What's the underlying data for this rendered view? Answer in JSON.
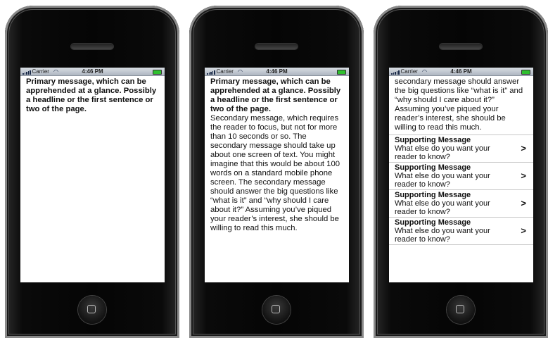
{
  "status": {
    "carrier": "Carrier",
    "time": "4:46 PM"
  },
  "screen1": {
    "primary": "Primary message, which can be apprehended at a glance. Possibly a headline or the first sentence or two of the page."
  },
  "screen2": {
    "primary": "Primary message, which can be apprehended at a glance. Possibly a headline or the first sentence or two of the page.",
    "secondary": "Secondary message, which requires the reader to focus, but not for more than 10 seconds or so. The secondary message should take up about one screen of text. You might imagine that this would be about 100 words on a standard mobile phone screen. The secondary message should answer the big questions like “what is it” and “why should I care about it?” Assuming you’ve piqued your reader’s interest, she should be willing to read this much."
  },
  "screen3": {
    "secondary_tail": "secondary message should answer the big questions like “what is it” and “why should I care about it?” Assuming you’ve piqued your reader’s interest, she should be willing to read this much.",
    "items": [
      {
        "title": "Supporting Message",
        "desc": "What else do you want your reader to know?",
        "chevron": ">"
      },
      {
        "title": "Supporting Message",
        "desc": "What else do you want your reader to know?",
        "chevron": ">"
      },
      {
        "title": "Supporting Message",
        "desc": "What else do you want your reader to know?",
        "chevron": ">"
      },
      {
        "title": "Supporting Message",
        "desc": "What else do you want your reader to know?",
        "chevron": ">"
      }
    ]
  },
  "icons": {
    "signal": "signal-bars-icon",
    "wifi": "wifi-icon",
    "battery": "battery-icon",
    "home": "home-button-icon"
  },
  "colors": {
    "battery": "#2ec02e",
    "statusbar": "#aeb6c1"
  }
}
